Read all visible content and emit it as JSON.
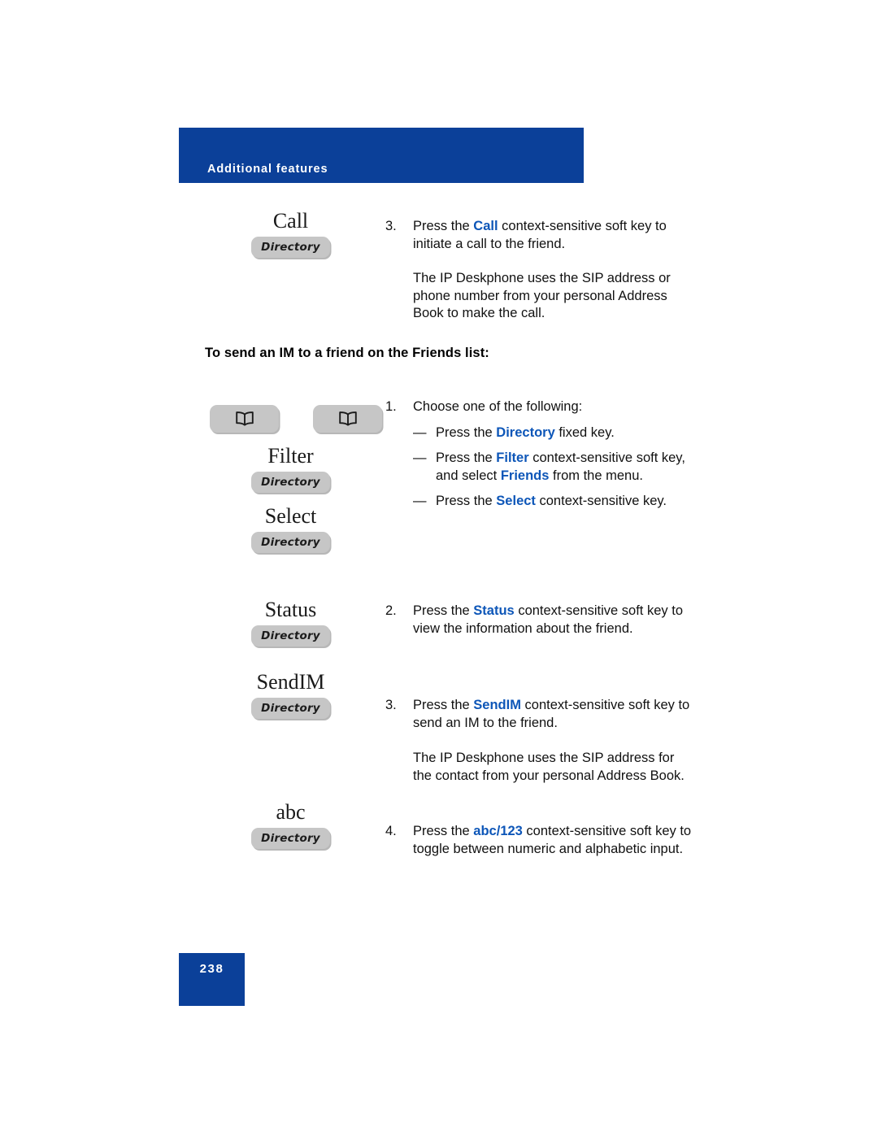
{
  "page": {
    "header_label": "Additional features",
    "page_number": "238",
    "accent_blue": "#0B4099",
    "keyword_blue": "#0D56B8",
    "softkey_gray": "#c6c6c6"
  },
  "section_heading": "To send an IM to a friend on the Friends list:",
  "keys": {
    "call": {
      "label": "Call",
      "button_text": "Directory"
    },
    "filter": {
      "label": "Filter",
      "button_text": "Directory"
    },
    "select": {
      "label": "Select",
      "button_text": "Directory"
    },
    "status": {
      "label": "Status",
      "button_text": "Directory"
    },
    "sendim": {
      "label": "SendIM",
      "button_text": "Directory"
    },
    "abc": {
      "label": "abc",
      "button_text": "Directory"
    },
    "directory_fixed_key_1": {
      "icon": "open-book-icon"
    },
    "directory_fixed_key_2": {
      "icon": "open-book-icon"
    }
  },
  "steps": {
    "call_step": {
      "number": "3.",
      "text_before": "Press the ",
      "keyword": "Call",
      "text_after": " context-sensitive soft key to initiate a call to the friend.",
      "note": "The IP Deskphone uses the SIP address or phone number from your personal Address Book to make the call."
    },
    "choose_step": {
      "number": "1.",
      "text": "Choose one of the following:",
      "bullets": [
        {
          "dash": "—",
          "before": "Press the ",
          "keyword": "Directory",
          "after": " fixed key."
        },
        {
          "dash": "—",
          "before": "Press the ",
          "keyword": "Filter",
          "mid": " context-sensitive soft key, and select ",
          "keyword2": "Friends",
          "after": " from the menu."
        },
        {
          "dash": "—",
          "before": "Press the ",
          "keyword": "Select",
          "after": " context-sensitive key."
        }
      ]
    },
    "status_step": {
      "number": "2.",
      "text_before": "Press the ",
      "keyword": "Status",
      "text_after": " context-sensitive soft key to view the information about the friend."
    },
    "sendim_step": {
      "number": "3.",
      "text_before": "Press the ",
      "keyword": "SendIM",
      "text_after": " context-sensitive soft key to send an IM to the friend.",
      "note": "The IP Deskphone uses the SIP address for the contact from your personal Address Book."
    },
    "abc_step": {
      "number": "4.",
      "text_before": "Press the ",
      "keyword": "abc/123",
      "text_after": " context-sensitive soft key to toggle between numeric and alphabetic input."
    }
  }
}
